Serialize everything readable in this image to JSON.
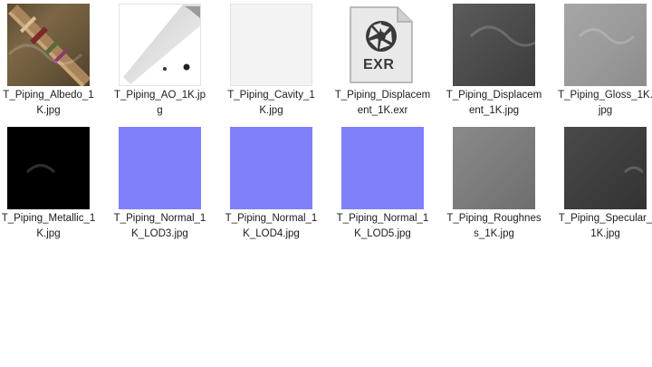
{
  "files": [
    {
      "label": "T_Piping_Albedo_1K.jpg",
      "icon": "albedo-texture"
    },
    {
      "label": "T_Piping_AO_1K.jpg",
      "icon": "ao-texture"
    },
    {
      "label": "T_Piping_Cavity_1K.jpg",
      "icon": "cavity-texture"
    },
    {
      "label": "T_Piping_Displacement_1K.exr",
      "icon": "exr-file-icon",
      "badge": "EXR"
    },
    {
      "label": "T_Piping_Displacement_1K.jpg",
      "icon": "displacement-texture"
    },
    {
      "label": "T_Piping_Gloss_1K.jpg",
      "icon": "gloss-texture"
    },
    {
      "label": "T_Piping_Metallic_1K.jpg",
      "icon": "metallic-texture"
    },
    {
      "label": "T_Piping_Normal_1K_LOD3.jpg",
      "icon": "normal-texture"
    },
    {
      "label": "T_Piping_Normal_1K_LOD4.jpg",
      "icon": "normal-texture"
    },
    {
      "label": "T_Piping_Normal_1K_LOD5.jpg",
      "icon": "normal-texture"
    },
    {
      "label": "T_Piping_Roughness_1K.jpg",
      "icon": "roughness-texture"
    },
    {
      "label": "T_Piping_Specular_1K.jpg",
      "icon": "specular-texture"
    }
  ],
  "colors": {
    "normal_map": "#8080fa",
    "text": "#1b1b1b",
    "exr_badge": "#3a3a3a"
  }
}
